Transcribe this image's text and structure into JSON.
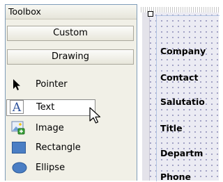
{
  "toolbox": {
    "title": "Toolbox",
    "categories": [
      {
        "label": "Custom"
      },
      {
        "label": "Drawing"
      }
    ],
    "items": [
      {
        "label": "Pointer",
        "icon": "pointer-arrow-icon"
      },
      {
        "label": "Text",
        "icon": "text-a-icon",
        "selected": true
      },
      {
        "label": "Image",
        "icon": "image-icon"
      },
      {
        "label": "Rectangle",
        "icon": "rectangle-icon"
      },
      {
        "label": "Ellipse",
        "icon": "ellipse-icon"
      }
    ]
  },
  "designer": {
    "fields": [
      "Company",
      "Contact",
      "Salutatio",
      "Title",
      "Departm",
      "Phone"
    ]
  },
  "colors": {
    "panel_bg": "#f1f0e7",
    "grid_bg": "#ebebf3",
    "shape_blue": "#4a7ec4"
  }
}
